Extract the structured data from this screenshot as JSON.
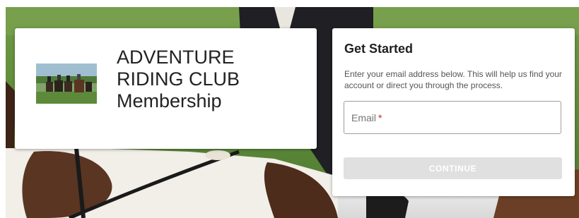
{
  "brand": {
    "title_line1": "ADVENTURE",
    "title_line2": "RIDING CLUB",
    "title_line3": "Membership",
    "logo_description_icon": "riders-photo-icon"
  },
  "get_started": {
    "title": "Get Started",
    "description": "Enter your email address below. This will help us find your account or direct you through the process.",
    "email_label": "Email",
    "email_required_marker": "*",
    "email_value": "",
    "continue_label": "CONTINUE",
    "continue_enabled": false
  },
  "colors": {
    "card_background": "#ffffff",
    "required_marker": "#c62828",
    "button_disabled_bg": "#e0e0e0",
    "button_disabled_text": "#ffffff",
    "grass_green": "#5f8a3b",
    "horse_brown": "#5a3522"
  }
}
